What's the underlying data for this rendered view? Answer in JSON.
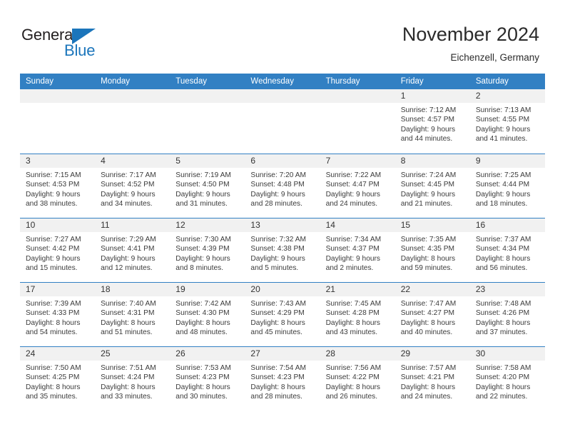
{
  "branding": {
    "logo_text_primary": "General",
    "logo_text_secondary": "Blue",
    "logo_triangle_icon": "triangle-icon",
    "primary_color": "#1b75bb",
    "header_color": "#3280c3"
  },
  "header": {
    "title": "November 2024",
    "subtitle": "Eichenzell, Germany"
  },
  "weekdays": [
    "Sunday",
    "Monday",
    "Tuesday",
    "Wednesday",
    "Thursday",
    "Friday",
    "Saturday"
  ],
  "weeks": [
    [
      {
        "day": "",
        "lines": []
      },
      {
        "day": "",
        "lines": []
      },
      {
        "day": "",
        "lines": []
      },
      {
        "day": "",
        "lines": []
      },
      {
        "day": "",
        "lines": []
      },
      {
        "day": "1",
        "lines": [
          "Sunrise: 7:12 AM",
          "Sunset: 4:57 PM",
          "Daylight: 9 hours",
          "and 44 minutes."
        ]
      },
      {
        "day": "2",
        "lines": [
          "Sunrise: 7:13 AM",
          "Sunset: 4:55 PM",
          "Daylight: 9 hours",
          "and 41 minutes."
        ]
      }
    ],
    [
      {
        "day": "3",
        "lines": [
          "Sunrise: 7:15 AM",
          "Sunset: 4:53 PM",
          "Daylight: 9 hours",
          "and 38 minutes."
        ]
      },
      {
        "day": "4",
        "lines": [
          "Sunrise: 7:17 AM",
          "Sunset: 4:52 PM",
          "Daylight: 9 hours",
          "and 34 minutes."
        ]
      },
      {
        "day": "5",
        "lines": [
          "Sunrise: 7:19 AM",
          "Sunset: 4:50 PM",
          "Daylight: 9 hours",
          "and 31 minutes."
        ]
      },
      {
        "day": "6",
        "lines": [
          "Sunrise: 7:20 AM",
          "Sunset: 4:48 PM",
          "Daylight: 9 hours",
          "and 28 minutes."
        ]
      },
      {
        "day": "7",
        "lines": [
          "Sunrise: 7:22 AM",
          "Sunset: 4:47 PM",
          "Daylight: 9 hours",
          "and 24 minutes."
        ]
      },
      {
        "day": "8",
        "lines": [
          "Sunrise: 7:24 AM",
          "Sunset: 4:45 PM",
          "Daylight: 9 hours",
          "and 21 minutes."
        ]
      },
      {
        "day": "9",
        "lines": [
          "Sunrise: 7:25 AM",
          "Sunset: 4:44 PM",
          "Daylight: 9 hours",
          "and 18 minutes."
        ]
      }
    ],
    [
      {
        "day": "10",
        "lines": [
          "Sunrise: 7:27 AM",
          "Sunset: 4:42 PM",
          "Daylight: 9 hours",
          "and 15 minutes."
        ]
      },
      {
        "day": "11",
        "lines": [
          "Sunrise: 7:29 AM",
          "Sunset: 4:41 PM",
          "Daylight: 9 hours",
          "and 12 minutes."
        ]
      },
      {
        "day": "12",
        "lines": [
          "Sunrise: 7:30 AM",
          "Sunset: 4:39 PM",
          "Daylight: 9 hours",
          "and 8 minutes."
        ]
      },
      {
        "day": "13",
        "lines": [
          "Sunrise: 7:32 AM",
          "Sunset: 4:38 PM",
          "Daylight: 9 hours",
          "and 5 minutes."
        ]
      },
      {
        "day": "14",
        "lines": [
          "Sunrise: 7:34 AM",
          "Sunset: 4:37 PM",
          "Daylight: 9 hours",
          "and 2 minutes."
        ]
      },
      {
        "day": "15",
        "lines": [
          "Sunrise: 7:35 AM",
          "Sunset: 4:35 PM",
          "Daylight: 8 hours",
          "and 59 minutes."
        ]
      },
      {
        "day": "16",
        "lines": [
          "Sunrise: 7:37 AM",
          "Sunset: 4:34 PM",
          "Daylight: 8 hours",
          "and 56 minutes."
        ]
      }
    ],
    [
      {
        "day": "17",
        "lines": [
          "Sunrise: 7:39 AM",
          "Sunset: 4:33 PM",
          "Daylight: 8 hours",
          "and 54 minutes."
        ]
      },
      {
        "day": "18",
        "lines": [
          "Sunrise: 7:40 AM",
          "Sunset: 4:31 PM",
          "Daylight: 8 hours",
          "and 51 minutes."
        ]
      },
      {
        "day": "19",
        "lines": [
          "Sunrise: 7:42 AM",
          "Sunset: 4:30 PM",
          "Daylight: 8 hours",
          "and 48 minutes."
        ]
      },
      {
        "day": "20",
        "lines": [
          "Sunrise: 7:43 AM",
          "Sunset: 4:29 PM",
          "Daylight: 8 hours",
          "and 45 minutes."
        ]
      },
      {
        "day": "21",
        "lines": [
          "Sunrise: 7:45 AM",
          "Sunset: 4:28 PM",
          "Daylight: 8 hours",
          "and 43 minutes."
        ]
      },
      {
        "day": "22",
        "lines": [
          "Sunrise: 7:47 AM",
          "Sunset: 4:27 PM",
          "Daylight: 8 hours",
          "and 40 minutes."
        ]
      },
      {
        "day": "23",
        "lines": [
          "Sunrise: 7:48 AM",
          "Sunset: 4:26 PM",
          "Daylight: 8 hours",
          "and 37 minutes."
        ]
      }
    ],
    [
      {
        "day": "24",
        "lines": [
          "Sunrise: 7:50 AM",
          "Sunset: 4:25 PM",
          "Daylight: 8 hours",
          "and 35 minutes."
        ]
      },
      {
        "day": "25",
        "lines": [
          "Sunrise: 7:51 AM",
          "Sunset: 4:24 PM",
          "Daylight: 8 hours",
          "and 33 minutes."
        ]
      },
      {
        "day": "26",
        "lines": [
          "Sunrise: 7:53 AM",
          "Sunset: 4:23 PM",
          "Daylight: 8 hours",
          "and 30 minutes."
        ]
      },
      {
        "day": "27",
        "lines": [
          "Sunrise: 7:54 AM",
          "Sunset: 4:23 PM",
          "Daylight: 8 hours",
          "and 28 minutes."
        ]
      },
      {
        "day": "28",
        "lines": [
          "Sunrise: 7:56 AM",
          "Sunset: 4:22 PM",
          "Daylight: 8 hours",
          "and 26 minutes."
        ]
      },
      {
        "day": "29",
        "lines": [
          "Sunrise: 7:57 AM",
          "Sunset: 4:21 PM",
          "Daylight: 8 hours",
          "and 24 minutes."
        ]
      },
      {
        "day": "30",
        "lines": [
          "Sunrise: 7:58 AM",
          "Sunset: 4:20 PM",
          "Daylight: 8 hours",
          "and 22 minutes."
        ]
      }
    ]
  ]
}
